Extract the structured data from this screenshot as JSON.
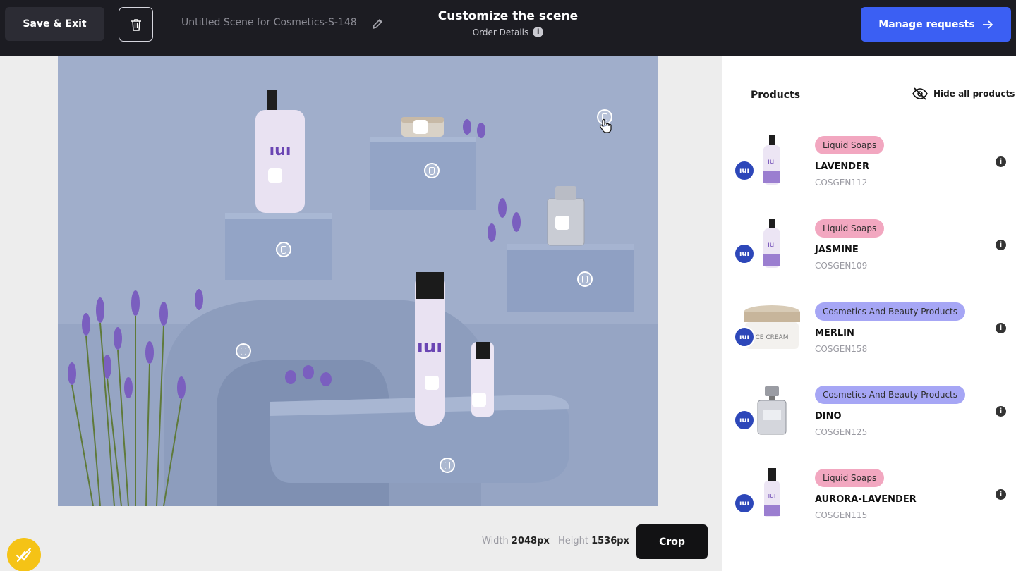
{
  "header": {
    "save_label": "Save & Exit",
    "scene_name": "Untitled Scene for Cosmetics-S-148",
    "title": "Customize the scene",
    "subtitle": "Order Details",
    "manage_label": "Manage requests",
    "info_glyph": "i"
  },
  "canvas": {
    "width_label": "Width",
    "width_value": "2048px",
    "height_label": "Height",
    "height_value": "1536px",
    "crop_label": "Crop"
  },
  "panel": {
    "title": "Products",
    "hide_all_label": "Hide all products",
    "products": [
      {
        "category": "Liquid Soaps",
        "name": "LAVENDER",
        "code": "COSGEN112",
        "kind": "bottle-soap"
      },
      {
        "category": "Liquid Soaps",
        "name": "JASMINE",
        "code": "COSGEN109",
        "kind": "bottle-soap"
      },
      {
        "category": "Cosmetics And Beauty Products",
        "name": "MERLIN",
        "code": "COSGEN158",
        "kind": "jar"
      },
      {
        "category": "Cosmetics And Beauty Products",
        "name": "DINO",
        "code": "COSGEN125",
        "kind": "perfume"
      },
      {
        "category": "Liquid Soaps",
        "name": "AURORA-LAVENDER",
        "code": "COSGEN115",
        "kind": "bottle-serum"
      }
    ]
  },
  "colors": {
    "topbar": "#1c1c22",
    "accent": "#3b5ff3",
    "pill_soap": "#f2a7c0",
    "pill_cosmetics": "#a6a6f5",
    "fab": "#f5c316"
  },
  "icons": [
    "trash-icon",
    "pencil-icon",
    "info-icon",
    "arrow-right-icon",
    "eye-off-icon",
    "hotspot-icon",
    "hand-cursor-icon"
  ]
}
